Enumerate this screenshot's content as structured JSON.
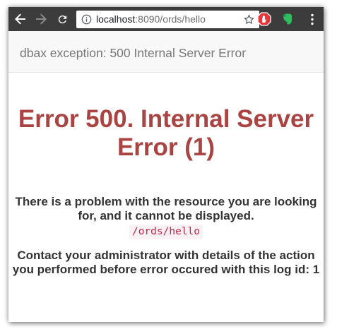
{
  "browser": {
    "url_host": "localhost",
    "url_path": ":8090/ords/hello",
    "icons": {
      "back": "arrow-left-icon",
      "forward": "arrow-right-icon",
      "reload": "reload-icon",
      "info": "info-icon",
      "bookmark": "star-icon",
      "extension_1": "adblock-stop-icon",
      "extension_2": "evernote-icon",
      "menu": "more-vertical-icon"
    },
    "colors": {
      "toolbar": "#3c3c3c",
      "extension_1": "#e8353a",
      "extension_2": "#2dbe60"
    }
  },
  "page": {
    "header_title": "dbax exception: 500 Internal Server Error",
    "error_title": "Error 500. Internal Server Error (1)",
    "message_1": "There is a problem with the resource you are looking for, and it cannot be displayed.",
    "resource_path": "/ords/hello",
    "message_2": "Contact your administrator with details of the action you performed before error occured with this log id: 1",
    "colors": {
      "error_title": "#a94442",
      "text": "#333333",
      "code": "#c7254e",
      "code_bg": "#f9f2f4"
    }
  }
}
